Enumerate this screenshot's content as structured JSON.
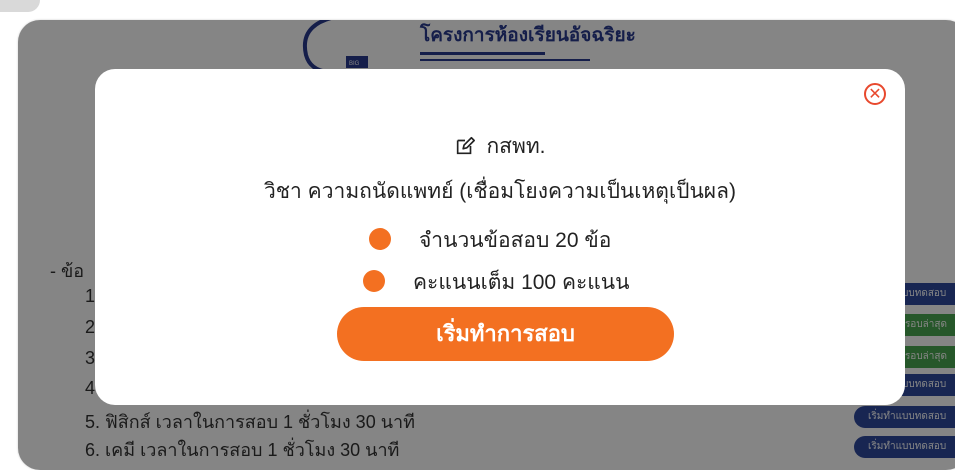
{
  "header": {
    "title": "โครงการห้องเรียนอัจฉริยะ"
  },
  "background": {
    "section_label": "- ข้อ",
    "numbers": [
      "1",
      "2",
      "3",
      "4"
    ],
    "list": [
      "5. ฟิสิกส์ เวลาในการสอบ 1 ชั่วโมง 30 นาที",
      "6. เคมี เวลาในการสอบ 1 ชั่วโมง 30 นาที"
    ],
    "buttons": [
      "เริ่มทำแบบทดสอบ",
      "ดูผลสอบรอบล่าสุด",
      "ดูผลสอบรอบล่าสุด",
      "เริ่มทำแบบทดสอบ",
      "เริ่มทำแบบทดสอบ",
      "เริ่มทำแบบทดสอบ"
    ]
  },
  "modal": {
    "code": "กสพท.",
    "subject": "วิชา ความถนัดแพทย์ (เชื่อมโยงความเป็นเหตุเป็นผล)",
    "items": [
      "จำนวนข้อสอบ 20 ข้อ",
      "คะแนนเต็ม 100 คะแนน"
    ],
    "start_label": "เริ่มทำการสอบ",
    "close_symbol": "✕"
  },
  "colors": {
    "accent": "#f37021",
    "close": "#e8492e",
    "brand": "#2a3b8f",
    "btn_blue": "#2f4a9e",
    "btn_green": "#4aa851"
  },
  "icons": {
    "code": "edit-icon",
    "close": "close-icon"
  }
}
